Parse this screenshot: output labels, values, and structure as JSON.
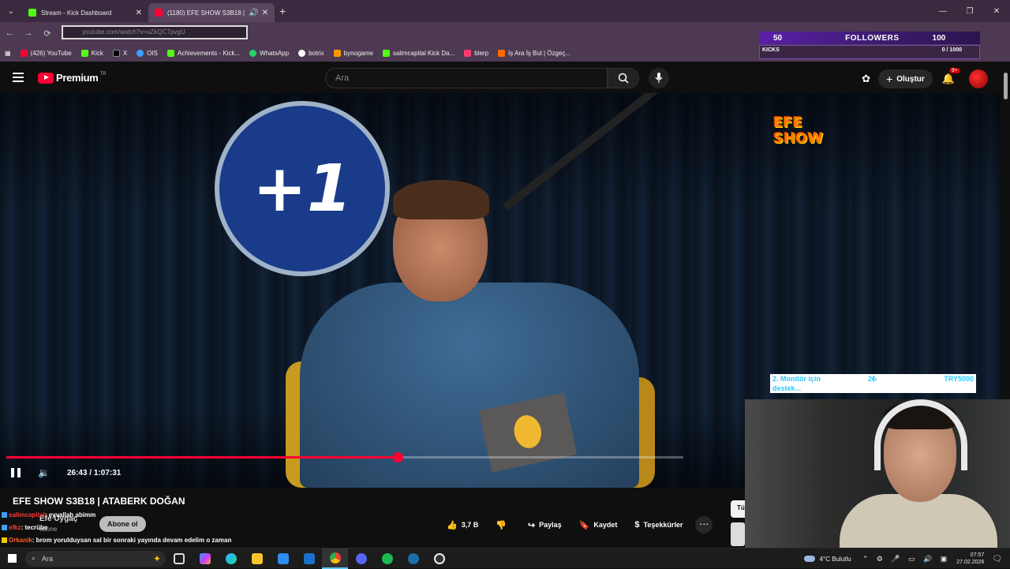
{
  "browser": {
    "tabs": [
      {
        "title": "Stream - Kick Dashboard",
        "icon": "kick-icon",
        "active": false
      },
      {
        "title": "(1180) EFE SHOW S3B18 | A",
        "icon": "youtube-icon",
        "active": true
      }
    ],
    "url": "youtube.com/watch?v=uZkQC7pvgU",
    "bookmarks": [
      {
        "label": "(426) YouTube",
        "icon": "youtube-icon",
        "color": "#ff0033"
      },
      {
        "label": "Kick",
        "icon": "kick-icon",
        "color": "#53fc18"
      },
      {
        "label": "X",
        "icon": "x-icon",
        "color": "#000000"
      },
      {
        "label": "OIS",
        "icon": "globe-icon",
        "color": "#3aa0ff"
      },
      {
        "label": "Achievements - Kick...",
        "icon": "kick-icon",
        "color": "#53fc18"
      },
      {
        "label": "WhatsApp",
        "icon": "whatsapp-icon",
        "color": "#25d366"
      },
      {
        "label": "botrix",
        "icon": "bot-icon",
        "color": "#ffffff"
      },
      {
        "label": "bynogame",
        "icon": "game-icon",
        "color": "#ff9900"
      },
      {
        "label": "salimcapital Kick Da...",
        "icon": "kick-icon",
        "color": "#53fc18"
      },
      {
        "label": "blerp",
        "icon": "blerp-icon",
        "color": "#ff3a6e"
      },
      {
        "label": "İş Ara İş Bul | Özgeç...",
        "icon": "job-icon",
        "color": "#ff6a00"
      }
    ]
  },
  "overlay": {
    "followers_count": "50",
    "followers_label": "FOLLOWERS",
    "followers_goal": "100",
    "kicks_label": "KICKS",
    "kicks_value": "0 / 1000",
    "donation": {
      "line1": "2. Monitör için",
      "amount": "2₺",
      "goal": "TRY5000",
      "line2": "destek..."
    }
  },
  "youtube": {
    "brand": "Premium",
    "region": "TR",
    "search_placeholder": "Ara",
    "create_label": "Oluştur",
    "notif_badge": "9+",
    "video": {
      "time_current": "26:43",
      "time_total": "1:07:31",
      "progress": 0.578,
      "title": "EFE SHOW S3B18 | ATABERK DOĞAN",
      "overlay_logo": "+1",
      "efe_logo_line1": "EFE",
      "efe_logo_line2": "SHOW"
    },
    "channel": {
      "name": "Efe Uygaç",
      "subs": "abone",
      "subscribe_label": "Abone ol"
    },
    "actions": [
      {
        "label": "3,7 B",
        "icon": "thumbs-up-icon"
      },
      {
        "label": "",
        "icon": "thumbs-down-icon"
      },
      {
        "label": "Paylaş",
        "icon": "share-icon"
      },
      {
        "label": "Kaydet",
        "icon": "save-icon"
      },
      {
        "label": "Teşekkürler",
        "icon": "thanks-icon"
      }
    ],
    "side_mini": "Tü"
  },
  "chat": [
    {
      "user": "salimcapital",
      "message": ": eyvallah abimm"
    },
    {
      "user": "efkz",
      "message": ": tecrübe"
    },
    {
      "user": "Orkanik",
      "message": ": brom yorulduysan sal bir sonraki yayında devam edelim o zaman"
    }
  ],
  "taskbar": {
    "search_placeholder": "Ara",
    "weather": "4°C  Bulutlu",
    "time": "07:57",
    "date": "27.02.2026"
  }
}
